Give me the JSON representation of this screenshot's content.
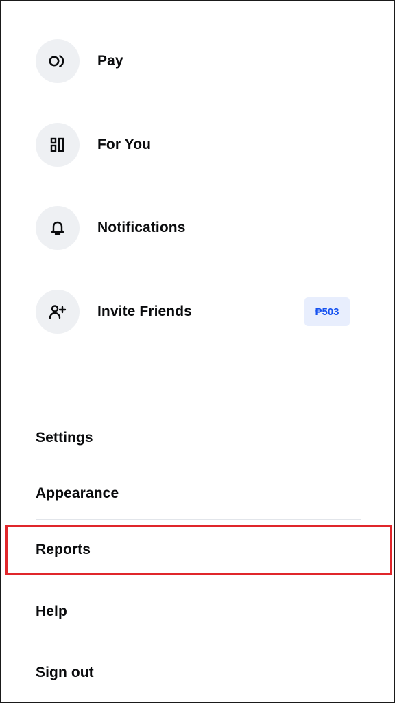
{
  "menu": {
    "primary": [
      {
        "id": "pay",
        "label": "Pay",
        "icon": "pay-icon"
      },
      {
        "id": "for-you",
        "label": "For You",
        "icon": "dashboard-icon"
      },
      {
        "id": "notifications",
        "label": "Notifications",
        "icon": "bell-icon"
      },
      {
        "id": "invite-friends",
        "label": "Invite Friends",
        "icon": "add-user-icon",
        "badge": "₱503"
      }
    ],
    "secondary": [
      {
        "id": "settings",
        "label": "Settings"
      },
      {
        "id": "appearance",
        "label": "Appearance"
      },
      {
        "id": "reports",
        "label": "Reports",
        "highlighted": true
      },
      {
        "id": "help",
        "label": "Help"
      },
      {
        "id": "sign-out",
        "label": "Sign out"
      }
    ]
  },
  "colors": {
    "text": "#0a0b0d",
    "icon_bg": "#eef0f3",
    "badge_bg": "#e8eefd",
    "badge_text": "#1652f0",
    "highlight_border": "#e0262b",
    "divider": "#d6dbe4"
  }
}
